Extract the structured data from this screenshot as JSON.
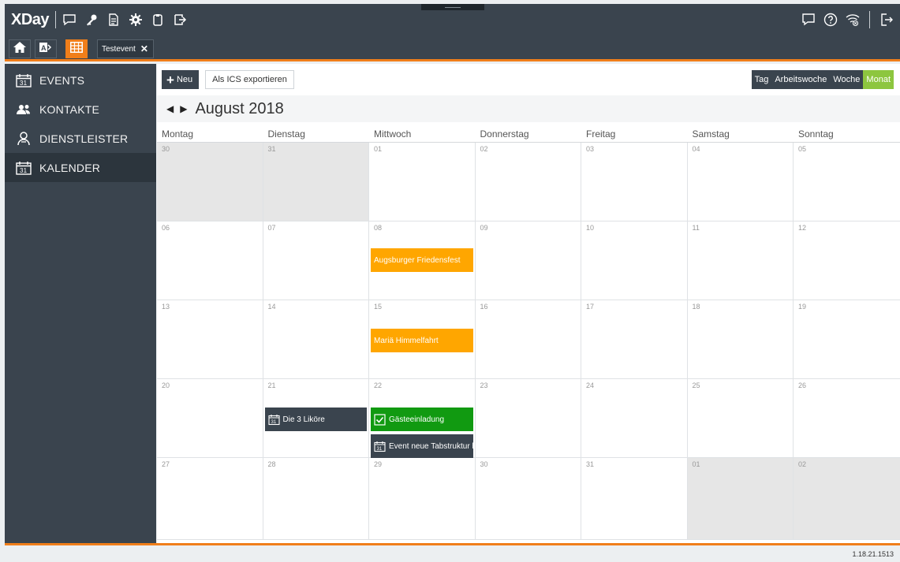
{
  "app": {
    "brand": "XDay",
    "version": "1.18.21.1513"
  },
  "tabs": {
    "doc_tab_label": "Testevent",
    "close_glyph": "✕"
  },
  "sidebar": {
    "items": [
      {
        "label": "EVENTS",
        "icon": "calendar-icon"
      },
      {
        "label": "KONTAKTE",
        "icon": "contacts-icon"
      },
      {
        "label": "DIENSTLEISTER",
        "icon": "provider-icon"
      },
      {
        "label": "KALENDER",
        "icon": "calendar-icon",
        "active": true
      }
    ]
  },
  "toolbar": {
    "new_label": "Neu",
    "ics_label": "Als ICS exportieren"
  },
  "views": {
    "day": "Tag",
    "workweek": "Arbeitswoche",
    "week": "Woche",
    "month": "Monat",
    "selected": "Monat"
  },
  "calendar": {
    "month_title": "August 2018",
    "weekdays": [
      "Montag",
      "Dienstag",
      "Mittwoch",
      "Donnerstag",
      "Freitag",
      "Samstag",
      "Sonntag"
    ],
    "weeks": [
      [
        "30",
        "31",
        "01",
        "02",
        "03",
        "04",
        "05"
      ],
      [
        "06",
        "07",
        "08",
        "09",
        "10",
        "11",
        "12"
      ],
      [
        "13",
        "14",
        "15",
        "16",
        "17",
        "18",
        "19"
      ],
      [
        "20",
        "21",
        "22",
        "23",
        "24",
        "25",
        "26"
      ],
      [
        "27",
        "28",
        "29",
        "30",
        "31",
        "01",
        "02"
      ]
    ],
    "events": {
      "e1": "Augsburger Friedensfest",
      "e2": "Mariä Himmelfahrt",
      "e3": "Die 3 Liköre",
      "e4": "Gästeeinladung",
      "e5": "Event neue Tabstruktur h"
    }
  },
  "colors": {
    "accent": "#f07e1a",
    "header": "#3a444e",
    "selected_view": "#8dc63f",
    "event_orange": "#ffa600",
    "event_green": "#119a11"
  }
}
